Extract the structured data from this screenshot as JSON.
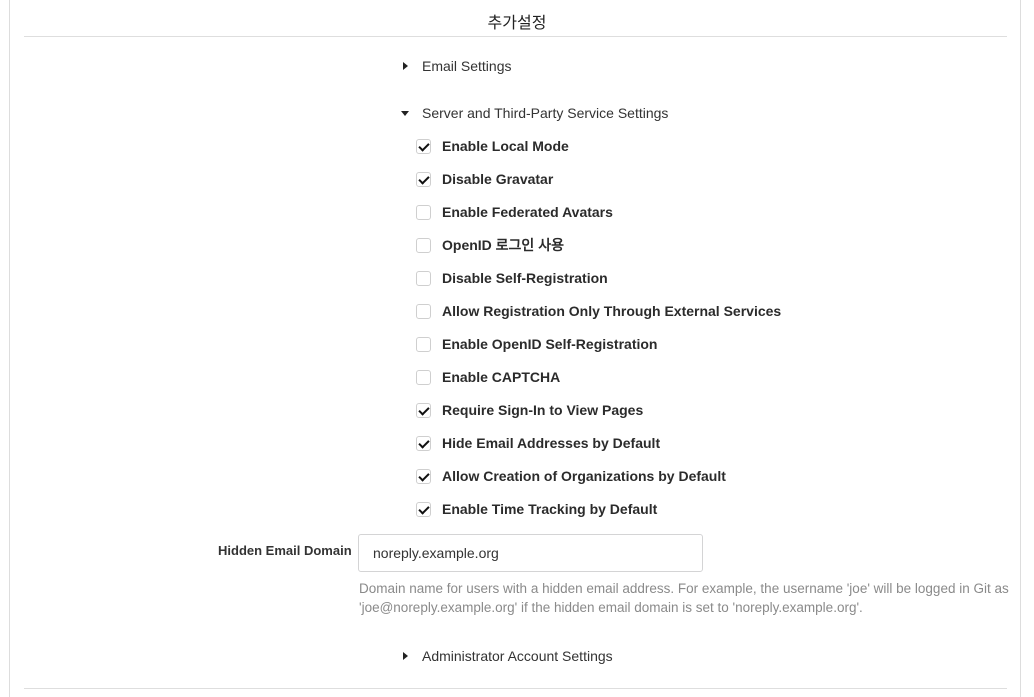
{
  "page": {
    "title": "추가설정"
  },
  "sections": {
    "email": {
      "label": "Email Settings",
      "expanded": false
    },
    "server": {
      "label": "Server and Third-Party Service Settings",
      "expanded": true
    },
    "admin": {
      "label": "Administrator Account Settings",
      "expanded": false
    }
  },
  "options": [
    {
      "label": "Enable Local Mode",
      "checked": true
    },
    {
      "label": "Disable Gravatar",
      "checked": true
    },
    {
      "label": "Enable Federated Avatars",
      "checked": false
    },
    {
      "label": "OpenID 로그인 사용",
      "checked": false
    },
    {
      "label": "Disable Self-Registration",
      "checked": false
    },
    {
      "label": "Allow Registration Only Through External Services",
      "checked": false
    },
    {
      "label": "Enable OpenID Self-Registration",
      "checked": false
    },
    {
      "label": "Enable CAPTCHA",
      "checked": false
    },
    {
      "label": "Require Sign-In to View Pages",
      "checked": true
    },
    {
      "label": "Hide Email Addresses by Default",
      "checked": true
    },
    {
      "label": "Allow Creation of Organizations by Default",
      "checked": true
    },
    {
      "label": "Enable Time Tracking by Default",
      "checked": true
    }
  ],
  "hidden_email_domain": {
    "label": "Hidden Email Domain",
    "value": "noreply.example.org",
    "help": "Domain name for users with a hidden email address. For example, the username 'joe' will be logged in Git as 'joe@noreply.example.org' if the hidden email domain is set to 'noreply.example.org'."
  }
}
